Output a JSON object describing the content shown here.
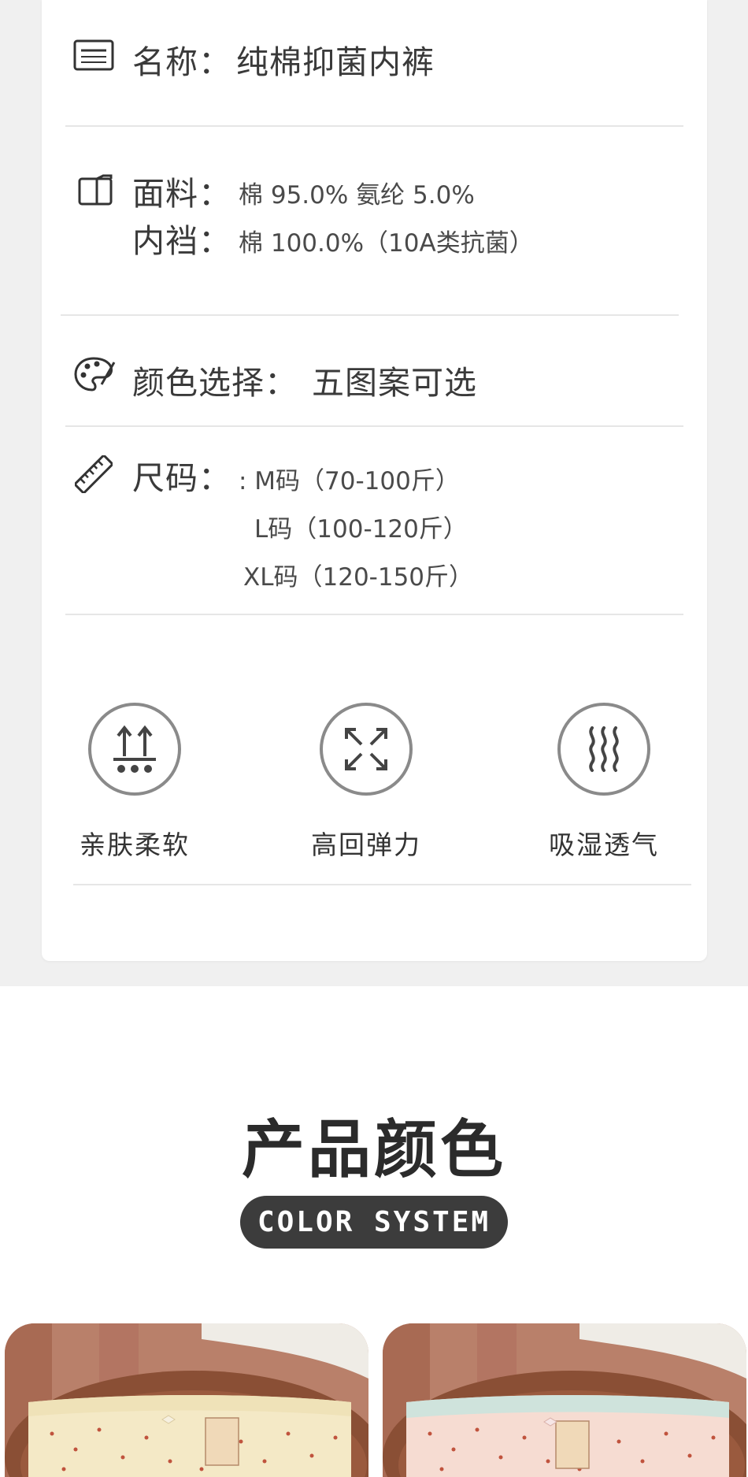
{
  "spec": {
    "name_label": "名称：",
    "name_value": "纯棉抑菌内裤",
    "fabric_label": "面料：",
    "fabric_value": "棉 95.0%   氨纶 5.0%",
    "lining_label": "内裆：",
    "lining_value": "棉 100.0%（10A类抗菌）",
    "color_label": "颜色选择：",
    "color_value": "五图案可选",
    "size_label": "尺码：",
    "sizes": [
      ":  M码（70-100斤）",
      "L码（100-120斤）",
      "XL码（120-150斤）"
    ]
  },
  "features": [
    {
      "label": "亲肤柔软",
      "icon": "soft-touch-icon"
    },
    {
      "label": "高回弹力",
      "icon": "elastic-arrows-icon"
    },
    {
      "label": "吸湿透气",
      "icon": "breathable-waves-icon"
    }
  ],
  "colors_section": {
    "title": "产品颜色",
    "subtitle": "COLOR SYSTEM"
  },
  "palette": {
    "pill_bg": "#3c3c3c",
    "photo1_fabric": "#f4e9c6",
    "photo2_fabric": "#f6dcd2",
    "wood": "#a9634a"
  }
}
